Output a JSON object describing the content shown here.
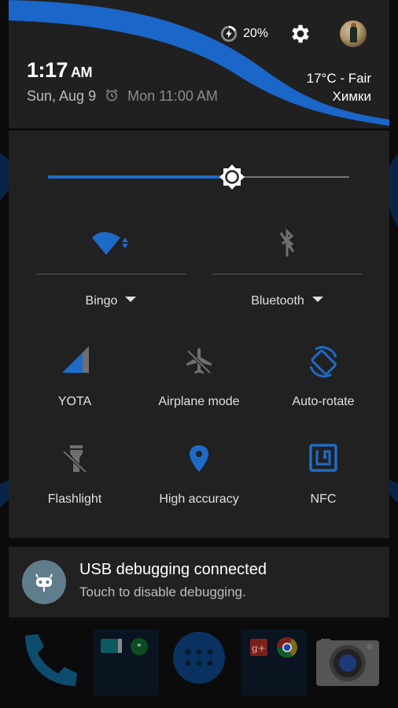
{
  "header": {
    "battery": {
      "icon": "battery-charging-icon",
      "percent_label": "20%",
      "level": 0.2
    },
    "settings_icon": "gear-icon",
    "avatar": "user-avatar",
    "time": "1:17",
    "ampm": "AM",
    "date": "Sun, Aug 9",
    "alarm_icon": "alarm-clock-icon",
    "next_alarm": "Mon 11:00 AM",
    "weather": {
      "condition": "17°C - Fair",
      "location": "Химки"
    }
  },
  "brightness": {
    "level_percent": 61,
    "icon": "brightness-auto-icon"
  },
  "quick_settings": {
    "wifi": {
      "label": "Bingo",
      "state": "on",
      "icon": "wifi-icon"
    },
    "bluetooth": {
      "label": "Bluetooth",
      "state": "off",
      "icon": "bluetooth-disabled-icon"
    },
    "tiles": [
      {
        "id": "mobile-data",
        "label": "YOTA",
        "state": "on",
        "icon": "signal-icon"
      },
      {
        "id": "airplane",
        "label": "Airplane mode",
        "state": "off",
        "icon": "airplane-off-icon"
      },
      {
        "id": "auto-rotate",
        "label": "Auto-rotate",
        "state": "on",
        "icon": "screen-rotation-icon"
      },
      {
        "id": "flashlight",
        "label": "Flashlight",
        "state": "off",
        "icon": "flashlight-off-icon"
      },
      {
        "id": "location",
        "label": "High accuracy",
        "state": "on",
        "icon": "location-pin-icon"
      },
      {
        "id": "nfc",
        "label": "NFC",
        "state": "on",
        "icon": "nfc-icon"
      }
    ]
  },
  "notification": {
    "icon": "cyanogenmod-android-icon",
    "title": "USB debugging connected",
    "text": "Touch to disable debugging."
  },
  "dock": {
    "items": [
      "phone-icon",
      "messaging-folder",
      "app-drawer-icon",
      "google-folder",
      "camera-icon"
    ]
  },
  "colors": {
    "accent": "#1e6bc7",
    "panel_bg": "#212121",
    "inactive_icon": "#6f6f6f",
    "text_primary": "#ffffff",
    "text_secondary": "#bdbdbd"
  }
}
